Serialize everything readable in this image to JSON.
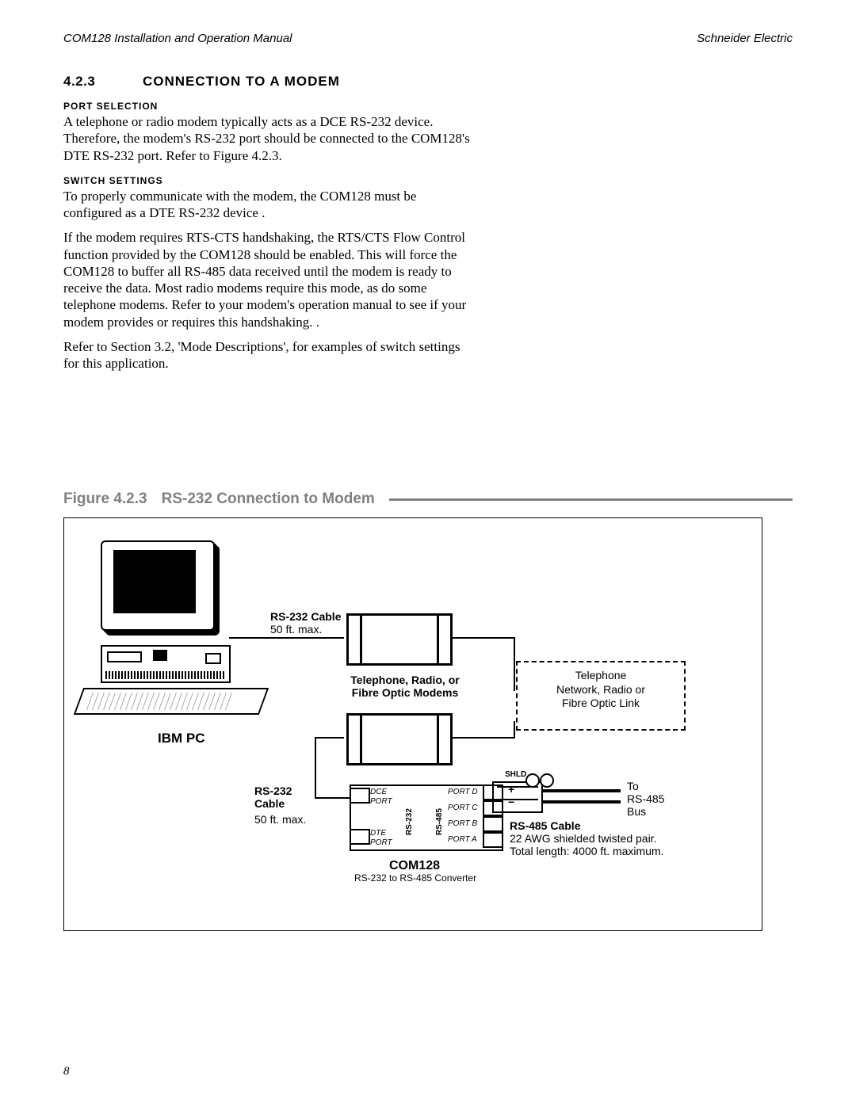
{
  "header": {
    "left": "COM128  Installation and Operation Manual",
    "right": "Schneider Electric"
  },
  "section": {
    "number": "4.2.3",
    "title": "CONNECTION TO A MODEM"
  },
  "port_selection": {
    "heading": "PORT  SELECTION",
    "text": "A telephone or radio modem typically acts as a DCE RS-232 device.  Therefore, the modem's RS-232 port should be connected to the COM128's DTE RS-232 port.  Refer to Figure 4.2.3."
  },
  "switch_settings": {
    "heading": "SWITCH  SETTINGS",
    "p1": "To properly communicate with the modem, the COM128 must be configured as a DTE RS-232 device .",
    "p2": "If the modem requires RTS-CTS handshaking, the RTS/CTS Flow Control function provided by the COM128 should be enabled. This will force the COM128 to buffer all RS-485 data received until the modem is ready to receive the data.  Most radio modems require this mode, as do some telephone modems.  Refer to your modem's operation manual to see if your modem provides or requires this handshaking.  .",
    "p3": "Refer to Section 3.2, 'Mode Descriptions', for examples of switch settings for this application."
  },
  "figure": {
    "label": "Figure 4.2.3",
    "title": "RS-232 Connection to Modem",
    "labels": {
      "rs232_cable": "RS-232 Cable",
      "rs232_cable_len": "50 ft. max.",
      "modems_label": "Telephone, Radio, or\nFibre Optic Modems",
      "link_label": "Telephone\nNetwork, Radio or\nFibre Optic Link",
      "pc_label": "IBM PC",
      "rs232_cable2": "RS-232\nCable",
      "rs232_cable2_len": "50 ft. max.",
      "dce_port": "DCE\nPORT",
      "dte_port": "DTE\nPORT",
      "rs232_v": "RS-232",
      "rs485_v": "RS-485",
      "port_d": "PORT D",
      "port_c": "PORT C",
      "port_b": "PORT B",
      "port_a": "PORT A",
      "shld": "SHLD",
      "plus": "+",
      "minus": "−",
      "to_bus": "To\nRS-485\nBus",
      "rs485_cable": "RS-485 Cable",
      "rs485_desc": "22 AWG shielded twisted pair.\nTotal length: 4000 ft. maximum.",
      "com128": "COM128",
      "com128_sub": "RS-232 to RS-485 Converter"
    }
  },
  "page_number": "8"
}
